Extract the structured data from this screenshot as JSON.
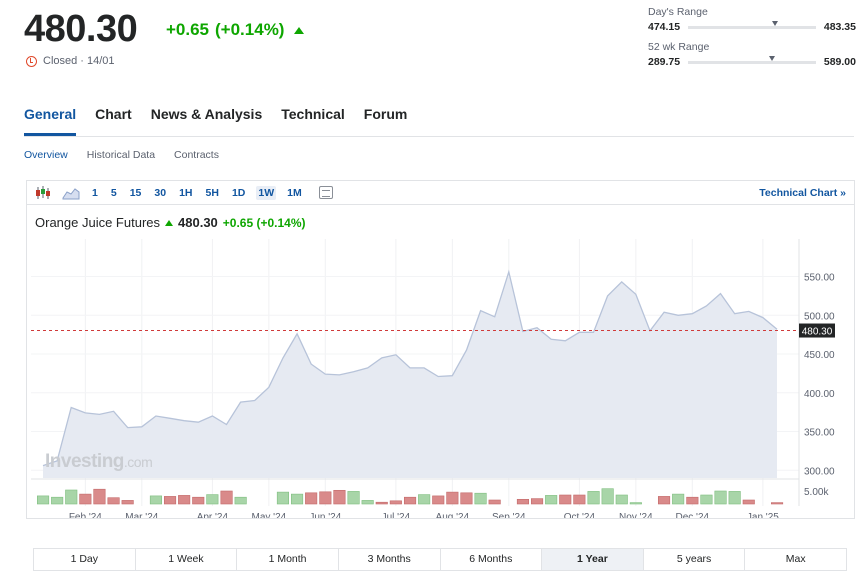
{
  "header": {
    "price": "480.30",
    "change": "+0.65",
    "change_pct": "(+0.14%)",
    "status": "Closed · 14/01"
  },
  "days_range": {
    "label": "Day's Range",
    "low": "474.15",
    "high": "483.35",
    "marker_fraction": 0.66
  },
  "wk52_range": {
    "label": "52 wk Range",
    "low": "289.75",
    "high": "589.00",
    "marker_fraction": 0.63
  },
  "tabs": [
    {
      "label": "General",
      "active": true
    },
    {
      "label": "Chart",
      "active": false
    },
    {
      "label": "News & Analysis",
      "active": false
    },
    {
      "label": "Technical",
      "active": false
    },
    {
      "label": "Forum",
      "active": false
    }
  ],
  "subtabs": [
    {
      "label": "Overview",
      "active": true
    },
    {
      "label": "Historical Data",
      "active": false
    },
    {
      "label": "Contracts",
      "active": false
    }
  ],
  "toolbar": {
    "candles_icon": "candlestick-icon",
    "area_icon": "area-chart-icon",
    "timeframes": [
      {
        "label": "1",
        "active": false
      },
      {
        "label": "5",
        "active": false
      },
      {
        "label": "15",
        "active": false
      },
      {
        "label": "30",
        "active": false
      },
      {
        "label": "1H",
        "active": false
      },
      {
        "label": "5H",
        "active": false
      },
      {
        "label": "1D",
        "active": false
      },
      {
        "label": "1W",
        "active": true
      },
      {
        "label": "1M",
        "active": false
      }
    ],
    "technical_chart_label": "Technical Chart »"
  },
  "legend": {
    "name": "Orange Juice Futures",
    "value": "480.30",
    "change": "+0.65 (+0.14%)"
  },
  "watermark": {
    "brand": "Investing",
    "suffix": ".com"
  },
  "colors": {
    "up": "#0ea600",
    "accent": "#1256a0",
    "area_fill": "#e6eaf2",
    "area_line": "#b7c3d9",
    "vol_up": "#a8d5a8",
    "vol_down": "#d98a8a",
    "price_line": "#d03a3a"
  },
  "chart_data": {
    "type": "area",
    "ylim": [
      290,
      570
    ],
    "yticks": [
      550,
      500,
      450,
      400,
      350,
      300
    ],
    "ytick_labels": [
      "550.00",
      "500.00",
      "450.00",
      "400.00",
      "350.00",
      "300.00"
    ],
    "last_price": 480.3,
    "last_price_label": "480.30",
    "volume_axis_label": "5.00k",
    "xtick_labels": [
      "Feb '24",
      "Mar '24",
      "Apr '24",
      "May '24",
      "Jun '24",
      "Jul '24",
      "Aug '24",
      "Sep '24",
      "Oct '24",
      "Nov '24",
      "Dec '24",
      "Jan '25"
    ],
    "weeks": 53,
    "xtick_week_index": [
      3,
      7,
      12,
      16,
      20,
      25,
      29,
      33,
      38,
      42,
      46,
      51
    ],
    "values": [
      306,
      312,
      381,
      374,
      372,
      376,
      355,
      356,
      370,
      367,
      364,
      362,
      370,
      359,
      388,
      390,
      407,
      445,
      476,
      437,
      424,
      423,
      427,
      432,
      445,
      449,
      432,
      432,
      421,
      422,
      455,
      506,
      498,
      556,
      479,
      484,
      469,
      467,
      478,
      478,
      525,
      543,
      527,
      480,
      504,
      500,
      502,
      512,
      528,
      502,
      505,
      497,
      482
    ],
    "volume": [
      0.45,
      0.38,
      0.78,
      0.55,
      0.82,
      0.35,
      0.2,
      0.0,
      0.45,
      0.42,
      0.48,
      0.38,
      0.52,
      0.72,
      0.38,
      0.0,
      0.0,
      0.66,
      0.55,
      0.62,
      0.68,
      0.76,
      0.7,
      0.2,
      0.1,
      0.18,
      0.38,
      0.52,
      0.45,
      0.66,
      0.62,
      0.6,
      0.22,
      0.0,
      0.26,
      0.3,
      0.48,
      0.5,
      0.5,
      0.7,
      0.85,
      0.5,
      0.08,
      0.0,
      0.42,
      0.55,
      0.38,
      0.5,
      0.72,
      0.7,
      0.22,
      0.0,
      0.08
    ],
    "volume_up": [
      1,
      1,
      1,
      0,
      0,
      0,
      0,
      0,
      1,
      0,
      0,
      0,
      1,
      0,
      1,
      0,
      0,
      1,
      1,
      0,
      0,
      0,
      1,
      1,
      0,
      0,
      0,
      1,
      0,
      0,
      0,
      1,
      0,
      0,
      0,
      0,
      1,
      0,
      0,
      1,
      1,
      1,
      1,
      0,
      0,
      1,
      0,
      1,
      1,
      1,
      0,
      0,
      0
    ]
  },
  "periods": [
    {
      "label": "1 Day",
      "active": false
    },
    {
      "label": "1 Week",
      "active": false
    },
    {
      "label": "1 Month",
      "active": false
    },
    {
      "label": "3 Months",
      "active": false
    },
    {
      "label": "6 Months",
      "active": false
    },
    {
      "label": "1 Year",
      "active": true
    },
    {
      "label": "5 years",
      "active": false
    },
    {
      "label": "Max",
      "active": false
    }
  ]
}
